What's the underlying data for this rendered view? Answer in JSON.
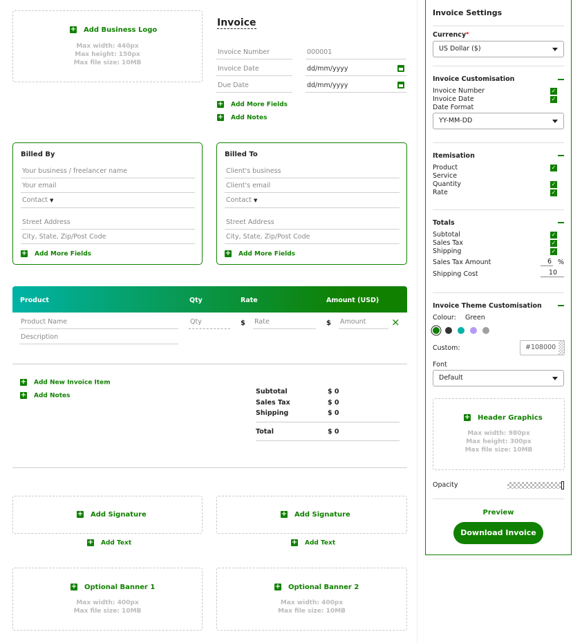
{
  "logo": {
    "add_label": "Add Business Logo",
    "line1": "Max width: 440px",
    "line2": "Max height: 150px",
    "line3": "Max file size: 10MB"
  },
  "invoice": {
    "title": "Invoice",
    "number_label": "Invoice Number",
    "number_value": "000001",
    "date_label": "Invoice Date",
    "date_value": "dd/mm/yyyy",
    "due_label": "Due Date",
    "due_value": "dd/mm/yyyy",
    "add_more_fields": "Add More Fields",
    "add_notes": "Add Notes"
  },
  "billed_by": {
    "title": "Billed By",
    "name_placeholder": "Your business / freelancer name",
    "email_placeholder": "Your email",
    "contact": "Contact",
    "street_placeholder": "Street Address",
    "city_placeholder": "City, State, Zip/Post Code",
    "add_more": "Add More Fields"
  },
  "billed_to": {
    "title": "Billed To",
    "name_placeholder": "Client's business",
    "email_placeholder": "Client's email",
    "contact": "Contact",
    "street_placeholder": "Street Address",
    "city_placeholder": "City, State, Zip/Post Code",
    "add_more": "Add More Fields"
  },
  "items_table": {
    "headers": [
      "Product",
      "Qty",
      "Rate",
      "Amount (USD)"
    ],
    "row": {
      "product": "Product Name",
      "qty": "Qty",
      "rate_symbol": "$",
      "rate": "Rate",
      "amount_symbol": "$",
      "amount": "Amount",
      "description": "Description",
      "remove": "×"
    }
  },
  "actions": {
    "add_item": "Add New Invoice Item",
    "add_notes": "Add Notes"
  },
  "totals": {
    "subtotal_label": "Subtotal",
    "subtotal_value": "$ 0",
    "tax_label": "Sales Tax",
    "tax_value": "$ 0",
    "shipping_label": "Shipping",
    "shipping_value": "$ 0",
    "total_label": "Total",
    "total_value": "$ 0"
  },
  "signature": {
    "add_label": "Add Signature",
    "add_text": "Add Text"
  },
  "banners": [
    {
      "label": "Optional Banner 1",
      "line1": "Max width: 400px",
      "line2": "Max file size: 10MB"
    },
    {
      "label": "Optional Banner 2",
      "line1": "Max width: 400px",
      "line2": "Max file size: 10MB"
    }
  ],
  "settings": {
    "title": "Invoice Settings",
    "currency_label": "Currency",
    "currency_required": "*",
    "currency_value": "US Dollar ($)",
    "customisation": {
      "title": "Invoice Customisation",
      "number": "Invoice Number",
      "date": "Invoice Date",
      "date_format_label": "Date Format",
      "date_format_value": "YY-MM-DD"
    },
    "itemisation": {
      "title": "Itemisation",
      "product": "Product",
      "service": "Service",
      "quantity": "Quantity",
      "rate": "Rate"
    },
    "totals": {
      "title": "Totals",
      "subtotal": "Subtotal",
      "sales_tax": "Sales Tax",
      "shipping": "Shipping",
      "tax_amount_label": "Sales Tax Amount",
      "tax_amount_value": "6",
      "tax_unit": "%",
      "shipping_cost_label": "Shipping Cost",
      "shipping_cost_value": "10"
    },
    "theme": {
      "title": "Invoice Theme Customisation",
      "colour_label": "Colour:",
      "colour_value": "Green",
      "custom_label": "Custom:",
      "custom_value": "#108000",
      "font_label": "Font",
      "font_value": "Default",
      "swatches": [
        "#108000",
        "#333333",
        "#00b3a6",
        "#b49cf5",
        "#a0a0a0"
      ]
    },
    "header_graphics": {
      "label": "Header Graphics",
      "line1": "Max width: 980px",
      "line2": "Max height: 300px",
      "line3": "Max file size: 10MB"
    },
    "opacity_label": "Opacity",
    "preview": "Preview",
    "download": "Download Invoice"
  },
  "colors": {
    "accent": "#108000",
    "teal": "#00b3a6"
  }
}
